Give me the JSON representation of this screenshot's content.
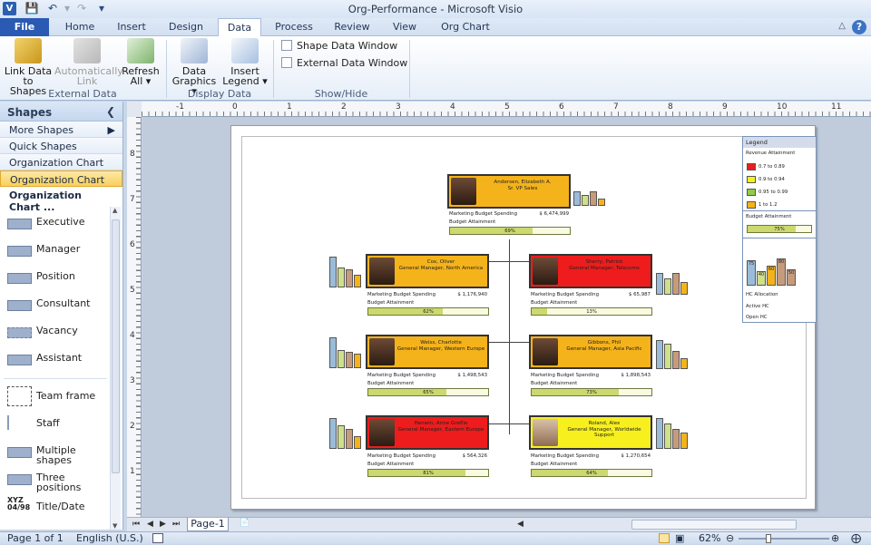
{
  "window": {
    "title": "Org-Performance - Microsoft Visio",
    "app_icon": "V"
  },
  "tabs": [
    "File",
    "Home",
    "Insert",
    "Design",
    "Data",
    "Process",
    "Review",
    "View",
    "Org Chart"
  ],
  "ribbon": {
    "link_data": "Link Data",
    "link_data_2": "to Shapes",
    "auto_link": "Automatically",
    "auto_link_2": "Link",
    "refresh": "Refresh",
    "refresh_2": "All",
    "data_graphics": "Data",
    "data_graphics_2": "Graphics",
    "insert_legend": "Insert",
    "insert_legend_2": "Legend",
    "group_external": "External Data",
    "group_display": "Display Data",
    "group_showhide": "Show/Hide",
    "shape_data_window": "Shape Data Window",
    "external_data_window": "External Data Window"
  },
  "shapes_panel": {
    "title": "Shapes",
    "rows": [
      "More Shapes",
      "Quick Shapes",
      "Organization Chart Sh...",
      "Organization Chart Sh..."
    ],
    "stencil_title": "Organization Chart ...",
    "items": [
      {
        "label": "Executive"
      },
      {
        "label": "Manager"
      },
      {
        "label": "Position"
      },
      {
        "label": "Consultant"
      },
      {
        "label": "Vacancy"
      },
      {
        "label": "Assistant"
      },
      {
        "label": "Team frame"
      },
      {
        "label": "Staff"
      },
      {
        "label": "Multiple",
        "label2": "shapes"
      },
      {
        "label": "Three",
        "label2": "positions"
      },
      {
        "label": "Title/Date"
      }
    ]
  },
  "ruler": {
    "top": [
      "-1",
      "0",
      "1",
      "2",
      "3",
      "4",
      "5",
      "6",
      "7",
      "8",
      "9",
      "10",
      "11"
    ],
    "left": [
      "8",
      "7",
      "6",
      "5",
      "4",
      "3",
      "2",
      "1"
    ]
  },
  "org": {
    "spend_label": "Marketing Budget Spending",
    "attain_label": "Budget Attainment",
    "nodes": [
      {
        "name": "Andersen, Elizabeth A.",
        "title": "Sr. VP Sales",
        "spend": "$ 6,474,999",
        "attainment": 69,
        "pct": "69%",
        "color": "#f5b31b"
      },
      {
        "name": "Cox, Oliver",
        "title": "General Manager,  North America",
        "spend": "$ 1,176,940",
        "attainment": 62,
        "pct": "62%",
        "color": "#f5b31b"
      },
      {
        "name": "Sherry, Patrick",
        "title": "General Manager, Telecoms",
        "spend": "$ 65,987",
        "attainment": 13,
        "pct": "13%",
        "color": "#ee1c1c"
      },
      {
        "name": "Weiss, Charlotte",
        "title": "General Manager, Western Europe",
        "spend": "$ 1,498,543",
        "attainment": 65,
        "pct": "65%",
        "color": "#f5b31b"
      },
      {
        "name": "Gibbons, Phil",
        "title": "General Manager, Asia Pacific",
        "spend": "$ 1,898,543",
        "attainment": 73,
        "pct": "73%",
        "color": "#f5b31b"
      },
      {
        "name": "Henwin, Anne Greflie",
        "title": "General Manager, Eastern Europe",
        "spend": "$ 564,326",
        "attainment": 81,
        "pct": "81%",
        "color": "#ee1c1c"
      },
      {
        "name": "Roland, Alex",
        "title": "General Manager, Worldwide Support",
        "spend": "$ 1,270,654",
        "attainment": 64,
        "pct": "64%",
        "color": "#f7f01e"
      }
    ]
  },
  "legend": {
    "title": "Legend",
    "revenue": "Revenue Attainment",
    "ranges": [
      {
        "label": "0.7 to 0.89",
        "color": "#ee1c1c"
      },
      {
        "label": "0.9 to 0.94",
        "color": "#f7f01e"
      },
      {
        "label": "0.95 to 0.99",
        "color": "#8fcb4e"
      },
      {
        "label": "1 to 1.2",
        "color": "#f5b31b"
      }
    ],
    "budget": "Budget Attainment",
    "budget_pct": "75%",
    "bars": [
      "75",
      "40",
      "60",
      "80",
      "50"
    ],
    "hc": "HC Allocation",
    "active": "Active HC",
    "open": "Open HC"
  },
  "page_tab": "Page-1",
  "status": {
    "page": "Page 1 of 1",
    "lang": "English (U.S.)",
    "zoom": "62%"
  }
}
